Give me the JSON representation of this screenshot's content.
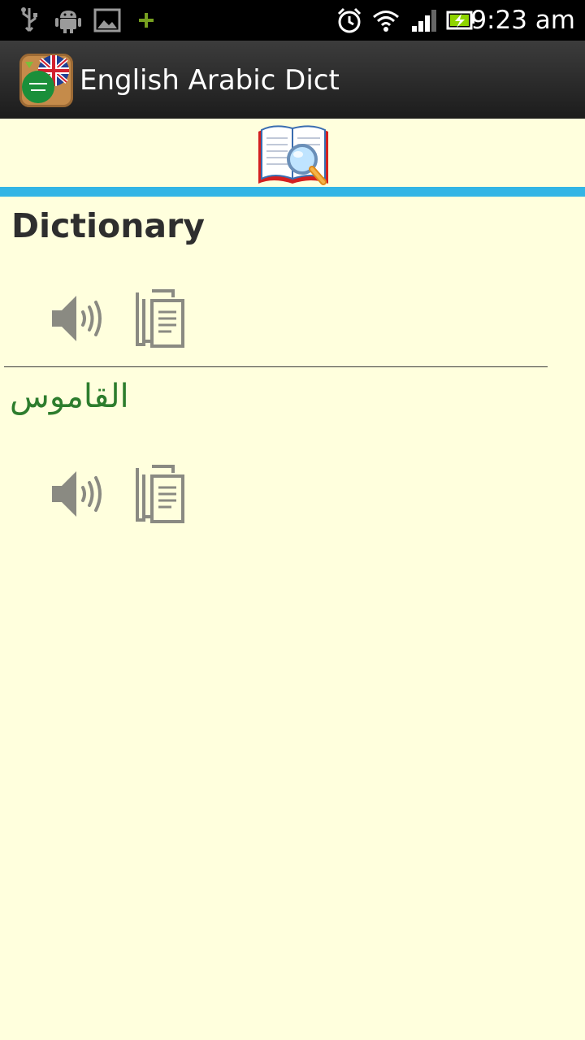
{
  "status_bar": {
    "time": "9:23 am",
    "icons": [
      "usb-icon",
      "android-debug-icon",
      "image-icon",
      "plus-icon",
      "alarm-clock-icon",
      "wifi-icon",
      "signal-icon",
      "battery-charging-icon"
    ]
  },
  "app": {
    "title": "English Arabic Dict",
    "logo_icon": "uk-saudi-flags-logo"
  },
  "header": {
    "search_icon": "book-magnifier-icon",
    "accent_color": "#33b5e5"
  },
  "entry": {
    "english_word": "Dictionary",
    "arabic_word": "القاموس",
    "english_actions": [
      "speaker-icon",
      "copy-icon"
    ],
    "arabic_actions": [
      "speaker-icon",
      "copy-icon"
    ]
  },
  "colors": {
    "background": "#ffffdd",
    "arabic_text": "#2d7d2d",
    "icon_gray": "#8a8a82"
  }
}
